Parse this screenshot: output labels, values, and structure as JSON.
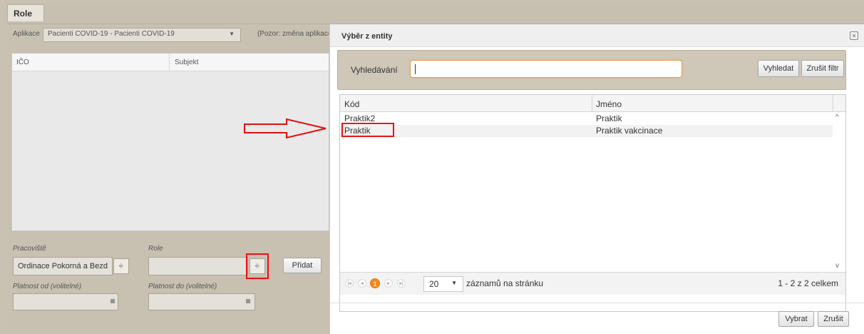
{
  "role_tab": "Role",
  "app": {
    "label": "Aplikace",
    "value": "Pacienti COVID-19 - Pacienti COVID-19",
    "note": "(Pozor: změna aplikace"
  },
  "left_grid": {
    "col1": "IČO",
    "col2": "Subjekt"
  },
  "form": {
    "pracoviste_label": "Pracoviště",
    "pracoviste_value": "Ordinace Pokorná a Bezd",
    "role_label": "Role",
    "role_value": "",
    "add_button": "Přidat",
    "platnost_od_label": "Platnost od (volitelné)",
    "platnost_do_label": "Platnost do (volitelné)"
  },
  "dialog": {
    "title": "Výběr z entity",
    "search_label": "Vyhledávání",
    "search_value": "",
    "search_button": "Vyhledat",
    "clear_filter_button": "Zrušit filtr",
    "columns": [
      "Kód",
      "Jméno"
    ],
    "rows": [
      {
        "code": "Praktik2",
        "name": "Praktik"
      },
      {
        "code": "Praktik",
        "name": "Praktik vakcinace"
      }
    ],
    "pager": {
      "current_page": "1",
      "page_size": "20",
      "page_size_label": "záznamů na stránku",
      "summary": "1 - 2 z 2 celkem"
    },
    "select_button": "Vybrat",
    "cancel_button": "Zrušit"
  },
  "colors": {
    "highlight": "#e11111",
    "accent": "#f08a24",
    "panel": "#c8c0b1"
  }
}
